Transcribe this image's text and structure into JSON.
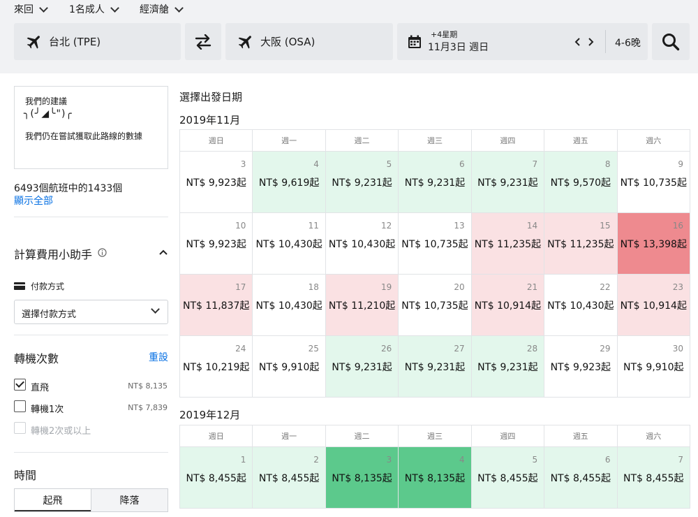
{
  "search": {
    "trip_type": "來回",
    "passengers": "1名成人",
    "cabin": "經濟艙",
    "origin": "台北 (TPE)",
    "destination": "大阪 (OSA)",
    "date_offset": "+4星期",
    "date": "11月3日 週日",
    "nights": "4-6晚"
  },
  "sidebar": {
    "suggestion_title": "我們的建議",
    "suggestion_face": "╮(╯◢╰\")╭",
    "suggestion_text": "我們仍在嘗試獲取此路線的數據",
    "flight_count": "6493個航班中的1433個",
    "show_all": "顯示全部",
    "calc_title": "計算費用小助手",
    "payment_label": "付款方式",
    "payment_select": "選擇付款方式",
    "stops_title": "轉機次數",
    "reset": "重設",
    "stops": [
      {
        "label": "直飛",
        "price": "NT$ 8,135",
        "checked": true
      },
      {
        "label": "轉機1次",
        "price": "NT$ 7,839",
        "checked": false
      },
      {
        "label": "轉機2次或以上",
        "price": "",
        "checked": false
      }
    ],
    "time_title": "時間",
    "time_tabs": [
      "起飛",
      "降落"
    ]
  },
  "main": {
    "heading": "選擇出發日期",
    "weekdays": [
      "週日",
      "週一",
      "週二",
      "週三",
      "週四",
      "週五",
      "週六"
    ],
    "months": [
      {
        "title": "2019年11月",
        "weeks": [
          [
            {
              "day": "3",
              "price": "NT$ 9,923起",
              "tone": "white"
            },
            {
              "day": "4",
              "price": "NT$ 9,619起",
              "tone": "green"
            },
            {
              "day": "5",
              "price": "NT$ 9,231起",
              "tone": "green"
            },
            {
              "day": "6",
              "price": "NT$ 9,231起",
              "tone": "green"
            },
            {
              "day": "7",
              "price": "NT$ 9,231起",
              "tone": "green"
            },
            {
              "day": "8",
              "price": "NT$ 9,570起",
              "tone": "green"
            },
            {
              "day": "9",
              "price": "NT$ 10,735起",
              "tone": "white"
            }
          ],
          [
            {
              "day": "10",
              "price": "NT$ 9,923起",
              "tone": "white"
            },
            {
              "day": "11",
              "price": "NT$ 10,430起",
              "tone": "white"
            },
            {
              "day": "12",
              "price": "NT$ 10,430起",
              "tone": "white"
            },
            {
              "day": "13",
              "price": "NT$ 10,735起",
              "tone": "white"
            },
            {
              "day": "14",
              "price": "NT$ 11,235起",
              "tone": "red"
            },
            {
              "day": "15",
              "price": "NT$ 11,235起",
              "tone": "red"
            },
            {
              "day": "16",
              "price": "NT$ 13,398起",
              "tone": "dred"
            }
          ],
          [
            {
              "day": "17",
              "price": "NT$ 11,837起",
              "tone": "red"
            },
            {
              "day": "18",
              "price": "NT$ 10,430起",
              "tone": "white"
            },
            {
              "day": "19",
              "price": "NT$ 11,210起",
              "tone": "red"
            },
            {
              "day": "20",
              "price": "NT$ 10,735起",
              "tone": "white"
            },
            {
              "day": "21",
              "price": "NT$ 10,914起",
              "tone": "red"
            },
            {
              "day": "22",
              "price": "NT$ 10,430起",
              "tone": "white"
            },
            {
              "day": "23",
              "price": "NT$ 10,914起",
              "tone": "red"
            }
          ],
          [
            {
              "day": "24",
              "price": "NT$ 10,219起",
              "tone": "white"
            },
            {
              "day": "25",
              "price": "NT$ 9,910起",
              "tone": "white"
            },
            {
              "day": "26",
              "price": "NT$ 9,231起",
              "tone": "green"
            },
            {
              "day": "27",
              "price": "NT$ 9,231起",
              "tone": "green"
            },
            {
              "day": "28",
              "price": "NT$ 9,231起",
              "tone": "green"
            },
            {
              "day": "29",
              "price": "NT$ 9,923起",
              "tone": "white"
            },
            {
              "day": "30",
              "price": "NT$ 9,910起",
              "tone": "white"
            }
          ]
        ]
      },
      {
        "title": "2019年12月",
        "weeks": [
          [
            {
              "day": "1",
              "price": "NT$ 8,455起",
              "tone": "green"
            },
            {
              "day": "2",
              "price": "NT$ 8,455起",
              "tone": "green"
            },
            {
              "day": "3",
              "price": "NT$ 8,135起",
              "tone": "dgreen"
            },
            {
              "day": "4",
              "price": "NT$ 8,135起",
              "tone": "dgreen"
            },
            {
              "day": "5",
              "price": "NT$ 8,455起",
              "tone": "green"
            },
            {
              "day": "6",
              "price": "NT$ 8,455起",
              "tone": "green"
            },
            {
              "day": "7",
              "price": "NT$ 8,455起",
              "tone": "green"
            }
          ]
        ]
      }
    ]
  },
  "colors": {
    "cheap": "#e3f7ec",
    "cheapest": "#5cc98c",
    "expensive": "#fae1e3",
    "most_expensive": "#ee8a8f",
    "accent_link": "#0770e3"
  },
  "icons": [
    "chevron-down-icon",
    "plane-icon",
    "swap-icon",
    "calendar-icon",
    "chevron-left-icon",
    "chevron-right-icon",
    "search-icon",
    "info-icon",
    "chevron-up-icon",
    "card-icon",
    "checkbox-icon"
  ]
}
